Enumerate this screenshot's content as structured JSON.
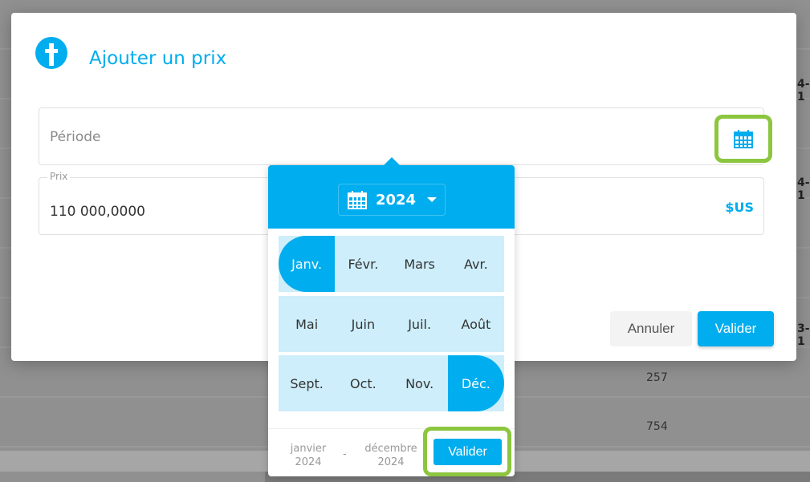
{
  "background": {
    "cells": [
      "4-1",
      "4-1",
      "3-1"
    ],
    "numbers": [
      "257",
      "754"
    ]
  },
  "modal": {
    "title": "Ajouter un prix",
    "period_placeholder": "Période",
    "price_label": "Prix",
    "price_value": "110 000,0000",
    "currency": "$US",
    "cancel_label": "Annuler",
    "submit_label": "Valider"
  },
  "picker": {
    "year": "2024",
    "months": [
      "Janv.",
      "Févr.",
      "Mars",
      "Avr.",
      "Mai",
      "Juin",
      "Juil.",
      "Août",
      "Sept.",
      "Oct.",
      "Nov.",
      "Déc."
    ],
    "range_start": {
      "month": "janvier",
      "year": "2024"
    },
    "range_end": {
      "month": "décembre",
      "year": "2024"
    },
    "separator": "-",
    "submit_label": "Valider"
  },
  "colors": {
    "accent": "#00adee",
    "highlight": "#8cc63f",
    "range": "#cdeefa"
  }
}
